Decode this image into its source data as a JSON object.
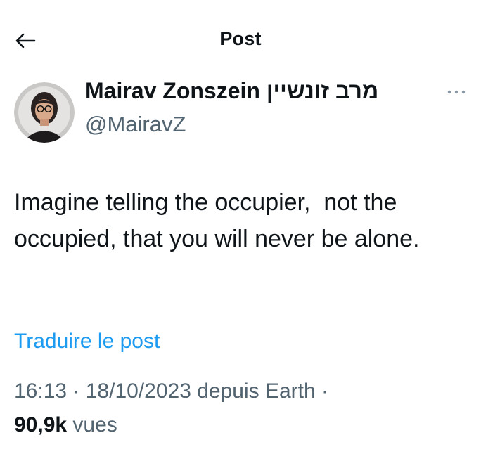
{
  "header": {
    "title": "Post",
    "back_icon": "arrow-left-icon"
  },
  "tweet": {
    "author": {
      "display_name": "Mairav Zonszein מרב זונשיין",
      "handle": "@MairavZ"
    },
    "more_icon": "more-dots-icon",
    "text": "Imagine telling the occupier,  not the occupied, that you will never be alone.",
    "translate_label": "Traduire le post",
    "timestamp": "16:13 · 18/10/2023 depuis Earth ·",
    "views_count": "90,9k",
    "views_label": "vues"
  },
  "colors": {
    "text": "#0f1419",
    "secondary": "#536471",
    "link": "#1d9bf0"
  }
}
